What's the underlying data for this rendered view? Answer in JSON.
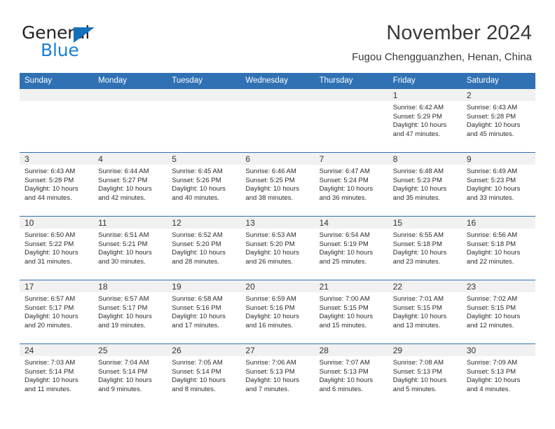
{
  "logo": {
    "word_top": "General",
    "word_bottom": "Blue",
    "triangle_icon": "triangle-icon",
    "color_dark": "#231f20",
    "color_blue": "#1b7fd4"
  },
  "header": {
    "title": "November 2024",
    "subtitle": "Fugou Chengguanzhen, Henan, China"
  },
  "theme": {
    "header_blue": "#3071b4",
    "daynum_band": "#f1f1f1",
    "row_divider": "#3071b4"
  },
  "columns": [
    "Sunday",
    "Monday",
    "Tuesday",
    "Wednesday",
    "Thursday",
    "Friday",
    "Saturday"
  ],
  "weeks": [
    [
      {
        "day": "",
        "lines": []
      },
      {
        "day": "",
        "lines": []
      },
      {
        "day": "",
        "lines": []
      },
      {
        "day": "",
        "lines": []
      },
      {
        "day": "",
        "lines": []
      },
      {
        "day": "1",
        "lines": [
          "Sunrise: 6:42 AM",
          "Sunset: 5:29 PM",
          "Daylight: 10 hours",
          "and 47 minutes."
        ]
      },
      {
        "day": "2",
        "lines": [
          "Sunrise: 6:43 AM",
          "Sunset: 5:28 PM",
          "Daylight: 10 hours",
          "and 45 minutes."
        ]
      }
    ],
    [
      {
        "day": "3",
        "lines": [
          "Sunrise: 6:43 AM",
          "Sunset: 5:28 PM",
          "Daylight: 10 hours",
          "and 44 minutes."
        ]
      },
      {
        "day": "4",
        "lines": [
          "Sunrise: 6:44 AM",
          "Sunset: 5:27 PM",
          "Daylight: 10 hours",
          "and 42 minutes."
        ]
      },
      {
        "day": "5",
        "lines": [
          "Sunrise: 6:45 AM",
          "Sunset: 5:26 PM",
          "Daylight: 10 hours",
          "and 40 minutes."
        ]
      },
      {
        "day": "6",
        "lines": [
          "Sunrise: 6:46 AM",
          "Sunset: 5:25 PM",
          "Daylight: 10 hours",
          "and 38 minutes."
        ]
      },
      {
        "day": "7",
        "lines": [
          "Sunrise: 6:47 AM",
          "Sunset: 5:24 PM",
          "Daylight: 10 hours",
          "and 36 minutes."
        ]
      },
      {
        "day": "8",
        "lines": [
          "Sunrise: 6:48 AM",
          "Sunset: 5:23 PM",
          "Daylight: 10 hours",
          "and 35 minutes."
        ]
      },
      {
        "day": "9",
        "lines": [
          "Sunrise: 6:49 AM",
          "Sunset: 5:23 PM",
          "Daylight: 10 hours",
          "and 33 minutes."
        ]
      }
    ],
    [
      {
        "day": "10",
        "lines": [
          "Sunrise: 6:50 AM",
          "Sunset: 5:22 PM",
          "Daylight: 10 hours",
          "and 31 minutes."
        ]
      },
      {
        "day": "11",
        "lines": [
          "Sunrise: 6:51 AM",
          "Sunset: 5:21 PM",
          "Daylight: 10 hours",
          "and 30 minutes."
        ]
      },
      {
        "day": "12",
        "lines": [
          "Sunrise: 6:52 AM",
          "Sunset: 5:20 PM",
          "Daylight: 10 hours",
          "and 28 minutes."
        ]
      },
      {
        "day": "13",
        "lines": [
          "Sunrise: 6:53 AM",
          "Sunset: 5:20 PM",
          "Daylight: 10 hours",
          "and 26 minutes."
        ]
      },
      {
        "day": "14",
        "lines": [
          "Sunrise: 6:54 AM",
          "Sunset: 5:19 PM",
          "Daylight: 10 hours",
          "and 25 minutes."
        ]
      },
      {
        "day": "15",
        "lines": [
          "Sunrise: 6:55 AM",
          "Sunset: 5:18 PM",
          "Daylight: 10 hours",
          "and 23 minutes."
        ]
      },
      {
        "day": "16",
        "lines": [
          "Sunrise: 6:56 AM",
          "Sunset: 5:18 PM",
          "Daylight: 10 hours",
          "and 22 minutes."
        ]
      }
    ],
    [
      {
        "day": "17",
        "lines": [
          "Sunrise: 6:57 AM",
          "Sunset: 5:17 PM",
          "Daylight: 10 hours",
          "and 20 minutes."
        ]
      },
      {
        "day": "18",
        "lines": [
          "Sunrise: 6:57 AM",
          "Sunset: 5:17 PM",
          "Daylight: 10 hours",
          "and 19 minutes."
        ]
      },
      {
        "day": "19",
        "lines": [
          "Sunrise: 6:58 AM",
          "Sunset: 5:16 PM",
          "Daylight: 10 hours",
          "and 17 minutes."
        ]
      },
      {
        "day": "20",
        "lines": [
          "Sunrise: 6:59 AM",
          "Sunset: 5:16 PM",
          "Daylight: 10 hours",
          "and 16 minutes."
        ]
      },
      {
        "day": "21",
        "lines": [
          "Sunrise: 7:00 AM",
          "Sunset: 5:15 PM",
          "Daylight: 10 hours",
          "and 15 minutes."
        ]
      },
      {
        "day": "22",
        "lines": [
          "Sunrise: 7:01 AM",
          "Sunset: 5:15 PM",
          "Daylight: 10 hours",
          "and 13 minutes."
        ]
      },
      {
        "day": "23",
        "lines": [
          "Sunrise: 7:02 AM",
          "Sunset: 5:15 PM",
          "Daylight: 10 hours",
          "and 12 minutes."
        ]
      }
    ],
    [
      {
        "day": "24",
        "lines": [
          "Sunrise: 7:03 AM",
          "Sunset: 5:14 PM",
          "Daylight: 10 hours",
          "and 11 minutes."
        ]
      },
      {
        "day": "25",
        "lines": [
          "Sunrise: 7:04 AM",
          "Sunset: 5:14 PM",
          "Daylight: 10 hours",
          "and 9 minutes."
        ]
      },
      {
        "day": "26",
        "lines": [
          "Sunrise: 7:05 AM",
          "Sunset: 5:14 PM",
          "Daylight: 10 hours",
          "and 8 minutes."
        ]
      },
      {
        "day": "27",
        "lines": [
          "Sunrise: 7:06 AM",
          "Sunset: 5:13 PM",
          "Daylight: 10 hours",
          "and 7 minutes."
        ]
      },
      {
        "day": "28",
        "lines": [
          "Sunrise: 7:07 AM",
          "Sunset: 5:13 PM",
          "Daylight: 10 hours",
          "and 6 minutes."
        ]
      },
      {
        "day": "29",
        "lines": [
          "Sunrise: 7:08 AM",
          "Sunset: 5:13 PM",
          "Daylight: 10 hours",
          "and 5 minutes."
        ]
      },
      {
        "day": "30",
        "lines": [
          "Sunrise: 7:09 AM",
          "Sunset: 5:13 PM",
          "Daylight: 10 hours",
          "and 4 minutes."
        ]
      }
    ]
  ]
}
